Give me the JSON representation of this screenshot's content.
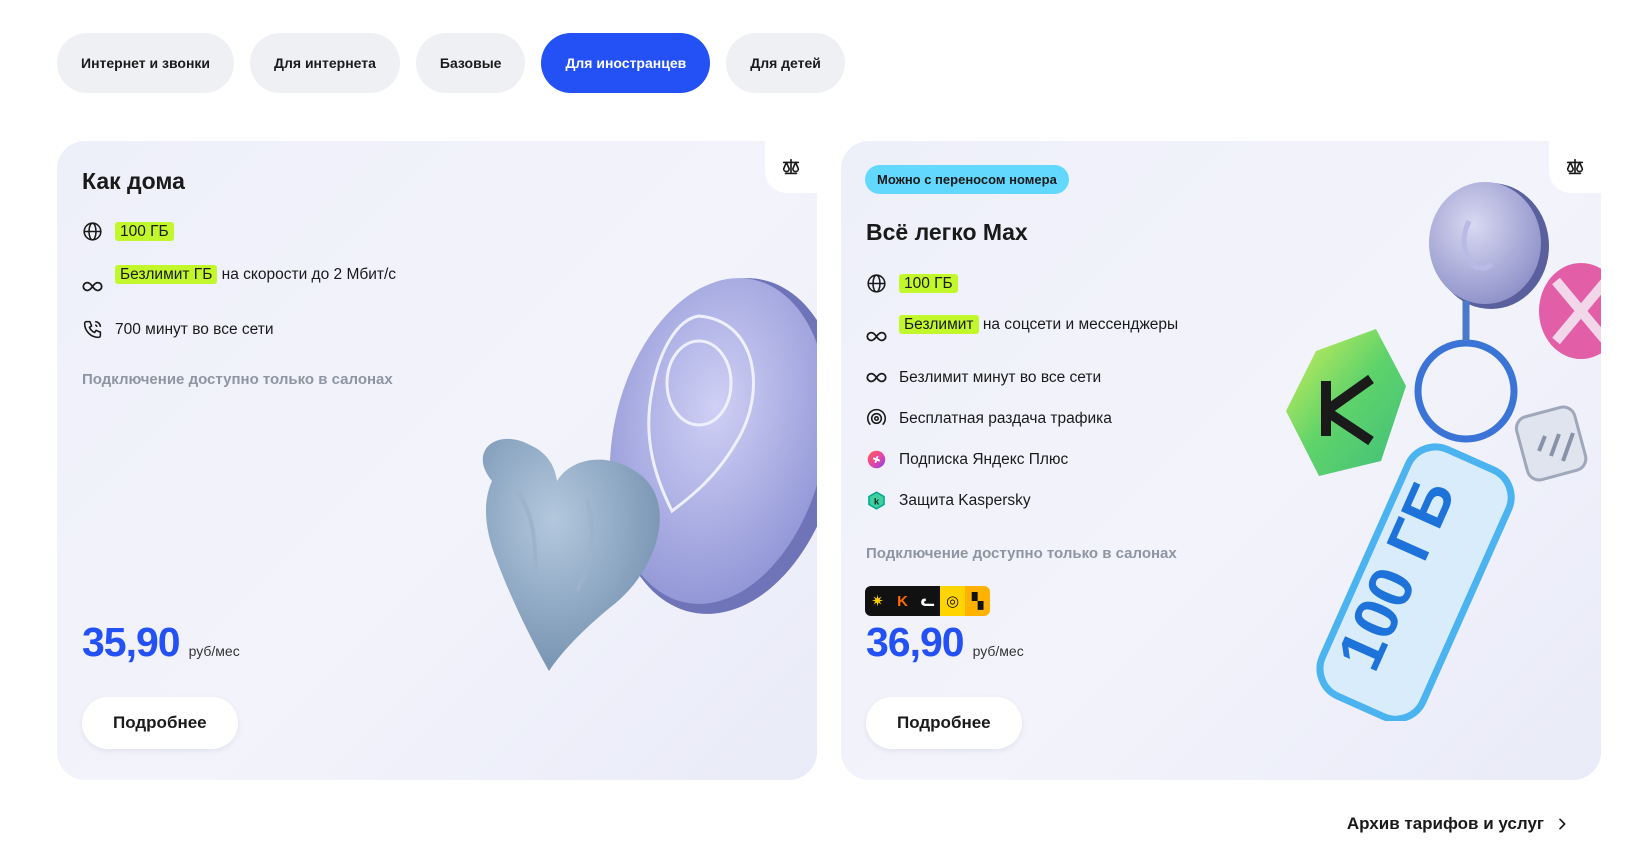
{
  "tabs": [
    {
      "label": "Интернет и звонки"
    },
    {
      "label": "Для интернета"
    },
    {
      "label": "Базовые"
    },
    {
      "label": "Для иностранцев",
      "active": true
    },
    {
      "label": "Для детей"
    }
  ],
  "cards": [
    {
      "title": "Как дома",
      "features": [
        {
          "icon": "globe-icon",
          "highlight": "100 ГБ",
          "text": ""
        },
        {
          "icon": "infinity-icon",
          "highlight": "Безлимит ГБ",
          "text": " на скорости до 2 Мбит/с"
        },
        {
          "icon": "phone-call-icon",
          "highlight": "",
          "text": "700 минут во все сети"
        }
      ],
      "note": "Подключение доступно только в салонах",
      "price": "35,90",
      "price_unit": "руб/мес",
      "button": "Подробнее"
    },
    {
      "badge": "Можно с переносом номера",
      "title": "Всё легко Max",
      "features": [
        {
          "icon": "globe-icon",
          "highlight": "100 ГБ",
          "text": ""
        },
        {
          "icon": "infinity-icon",
          "highlight": "Безлимит",
          "text": " на соцсети и мессенджеры"
        },
        {
          "icon": "infinity-icon",
          "highlight": "",
          "text": "Безлимит минут во все сети"
        },
        {
          "icon": "broadcast-icon",
          "highlight": "",
          "text": "Бесплатная раздача трафика"
        },
        {
          "icon": "yandex-plus-icon",
          "highlight": "",
          "text": "Подписка Яндекс Плюс"
        },
        {
          "icon": "kaspersky-icon",
          "highlight": "",
          "text": "Защита Kaspersky"
        }
      ],
      "note": "Подключение доступно только в салонах",
      "apps": [
        {
          "glyph": "✷",
          "bg": "#111111",
          "fg": "#ffcc00"
        },
        {
          "glyph": "K",
          "bg": "#111111",
          "fg": "#ff6a00"
        },
        {
          "glyph": "ᓚ",
          "bg": "#111111",
          "fg": "#ffffff"
        },
        {
          "glyph": "◎",
          "bg": "#ffd400",
          "fg": "#111111"
        },
        {
          "glyph": "▚",
          "bg": "#ffb300",
          "fg": "#111111"
        }
      ],
      "price": "36,90",
      "price_unit": "руб/мес",
      "button": "Подробнее",
      "tag_text": "100 ГБ"
    }
  ],
  "archive_link": "Архив тарифов и услуг",
  "colors": {
    "accent": "#2351f5",
    "highlight": "#c2f72c",
    "badge": "#62d8ff"
  }
}
